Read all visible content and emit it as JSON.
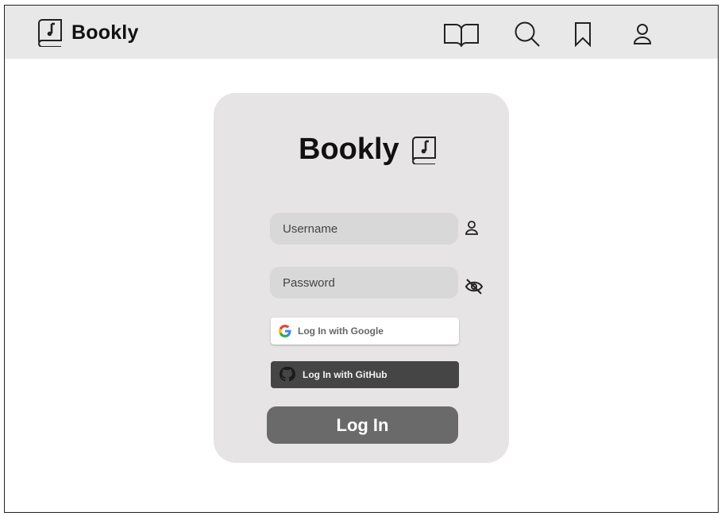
{
  "app": {
    "name": "Bookly"
  },
  "navbar": {
    "brand": "Bookly",
    "icons": [
      "open-book-icon",
      "search-icon",
      "bookmark-icon",
      "user-icon"
    ]
  },
  "login": {
    "title": "Bookly",
    "username": {
      "placeholder": "Username",
      "value": ""
    },
    "password": {
      "placeholder": "Password",
      "value": ""
    },
    "google_label": "Log In with Google",
    "github_label": "Log In with GitHub",
    "submit_label": "Log In"
  },
  "colors": {
    "navbar_bg": "#e8e8e8",
    "card_bg": "#e6e4e5",
    "field_bg": "#d8d8d8",
    "github_bg": "#454545",
    "login_button_bg": "#6a6a6a"
  }
}
